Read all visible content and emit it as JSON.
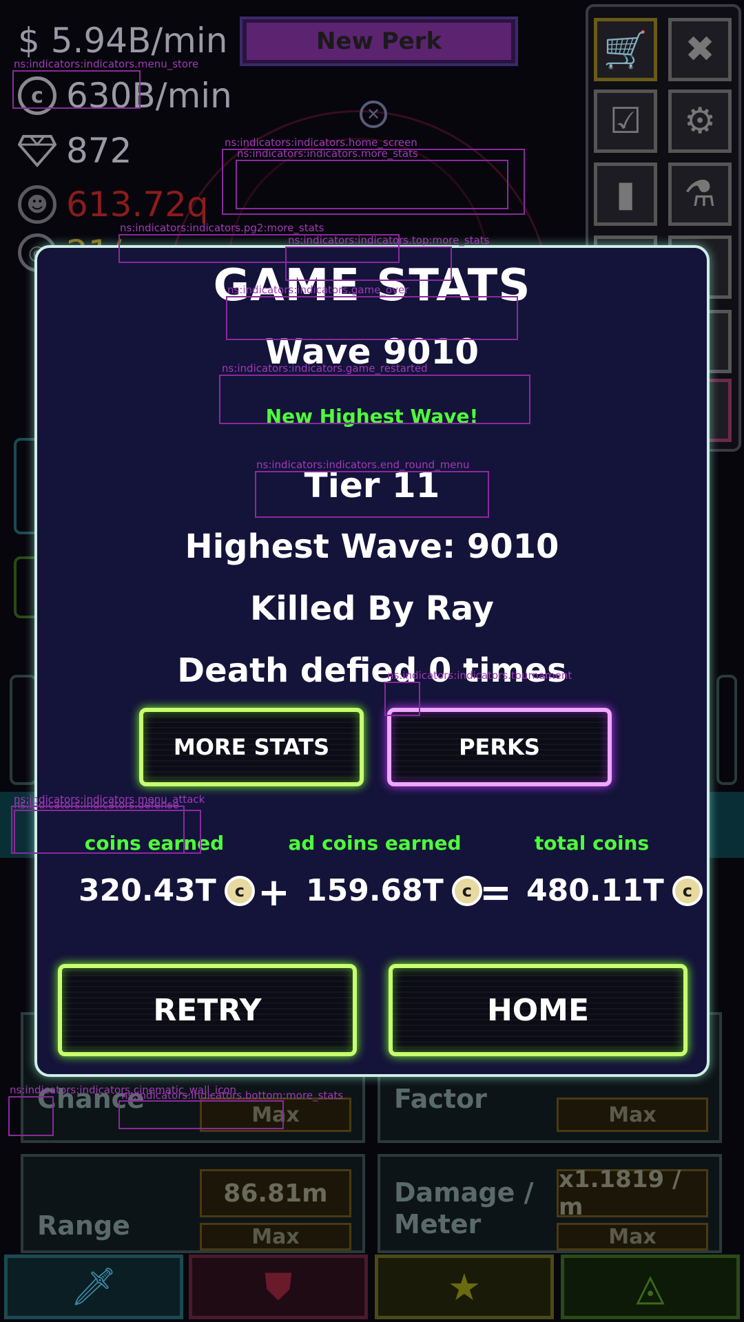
{
  "hud": {
    "cash_rate": "$ 5.94B/min",
    "coin_rate": "630B/min",
    "gems": "872",
    "power_stones": "613.72q",
    "partial_value": "21/",
    "coin_symbol": "c",
    "new_perk_label": "New Perk"
  },
  "menu_icons": [
    "shop-cart-icon",
    "close-x-icon",
    "checklist-icon",
    "gear-icon",
    "card-icon",
    "flask-icon"
  ],
  "upgrades": {
    "chance_label": "Chance",
    "chance_max": "Max",
    "factor_label": "Factor",
    "factor_max": "Max",
    "range_label": "Range",
    "range_value": "86.81m",
    "range_max": "Max",
    "damage_meter_label_1": "Damage /",
    "damage_meter_label_2": "Meter",
    "damage_meter_value": "x1.1819 / m",
    "damage_meter_max": "Max"
  },
  "bottom_tabs": [
    "sword-icon",
    "shield-icon",
    "star-icon",
    "triangle-eye-icon"
  ],
  "indicators": [
    "ns:indicators:indicators.menu_store",
    "ns:indicators:indicators.home_screen",
    "ns:indicators:indicators.more_stats",
    "ns:indicators:indicators.pg2:more_stats",
    "ns:indicators:indicators.top:more_stats",
    "ns:indicators:indicators.game_over",
    "ns:indicators:indicators.game_restarted",
    "ns:indicators:indicators.end_round_menu",
    "ns:indicators:indicators.tournament",
    "ns:indicators:indicators.menu_attack",
    "ns:indicators:indicators.defense",
    "ns:indicators:indicators.cinematic_wall_icon",
    "ns:indicators:indicators.bottom:more_stats"
  ],
  "modal": {
    "title": "GAME STATS",
    "wave": "Wave 9010",
    "new_highest": "New Highest Wave!",
    "tier": "Tier 11",
    "highest_wave": "Highest Wave: 9010",
    "killed_by": "Killed By Ray",
    "death_defied": "Death defied 0 times",
    "more_stats_button": "MORE STATS",
    "perks_button": "PERKS",
    "coins_earned_label": "coins earned",
    "ad_coins_label": "ad coins earned",
    "total_coins_label": "total coins",
    "coins_earned": "320.43T",
    "ad_coins": "159.68T",
    "total_coins": "480.11T",
    "plus": "+",
    "equals": "=",
    "coin_symbol": "c",
    "retry_button": "RETRY",
    "home_button": "HOME"
  }
}
